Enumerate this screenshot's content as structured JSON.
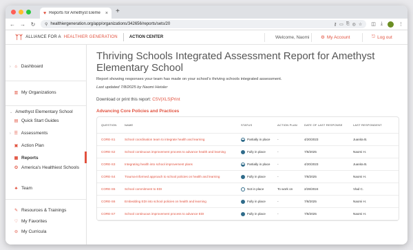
{
  "browser": {
    "tab_title": "Reports for Amethyst Eleme",
    "url": "healthiergeneration.org/app/organizations/342656/reports/sets/20"
  },
  "header": {
    "logo_part1": "ALLIANCE FOR A",
    "logo_part2": "HEALTHIER GENERATION",
    "action_center": "ACTION CENTER",
    "welcome": "Welcome, Naomi",
    "my_account": "My Account",
    "log_out": "Log out"
  },
  "sidebar": {
    "dashboard": "Dashboard",
    "my_organizations": "My Organizations",
    "school": "Amethyst Elementary School",
    "quick_start": "Quick Start Guides",
    "assessments": "Assessments",
    "action_plan": "Action Plan",
    "reports": "Reports",
    "healthiest_schools": "America's Healthiest Schools",
    "team": "Team",
    "resources": "Resources & Trainings",
    "favorites": "My Favorites",
    "curricula": "My Curricula"
  },
  "main": {
    "title": "Thriving Schools Integrated Assessment Report for Amethyst Elementary School",
    "description": "Report showing responses your team has made on your school's thriving schools integrated assessment.",
    "updated": "Last updated 7/8/2025 by Naomi Heisler",
    "download_prefix": "Download or print this report:",
    "csv": "CSV",
    "xls": "XLS",
    "print": "Print",
    "section": "Advancing Core Policies and Practices",
    "columns": [
      "Question",
      "Name",
      "Status",
      "Action Plan",
      "Date of Last Response",
      "Last Respondent"
    ],
    "rows": [
      {
        "code": "CORE-S1",
        "name": "School coordination team to integrate health and learning",
        "status": "Partially in place",
        "status_kind": "part",
        "plan": "-",
        "date": "4/20/2023",
        "respondent": "Juanita B."
      },
      {
        "code": "CORE-S2",
        "name": "School continuous improvement process to advance health and learning",
        "status": "Fully in place",
        "status_kind": "full",
        "plan": "-",
        "date": "7/8/2025",
        "respondent": "Naomi H."
      },
      {
        "code": "CORE-S3",
        "name": "Integrating health into school improvement plans",
        "status": "Partially in place",
        "status_kind": "part",
        "plan": "-",
        "date": "4/20/2023",
        "respondent": "Juanita B."
      },
      {
        "code": "CORE-S4",
        "name": "Trauma-informed approach to school policies on health and learning",
        "status": "Fully in place",
        "status_kind": "full",
        "plan": "-",
        "date": "7/8/2025",
        "respondent": "Naomi H."
      },
      {
        "code": "CORE-S5",
        "name": "School commitment to EDI",
        "status": "Not in place",
        "status_kind": "none",
        "plan": "To work on",
        "date": "2/28/2024",
        "respondent": "Vlad C."
      },
      {
        "code": "CORE-S6",
        "name": "Embedding EDI into school policies on health and learning",
        "status": "Fully in place",
        "status_kind": "full",
        "plan": "-",
        "date": "7/8/2025",
        "respondent": "Naomi H."
      },
      {
        "code": "CORE-S7",
        "name": "School continuous improvement process to advance EDI",
        "status": "Fully in place",
        "status_kind": "full",
        "plan": "-",
        "date": "7/8/2025",
        "respondent": "Naomi H."
      }
    ]
  },
  "colors": {
    "accent": "#e1513e",
    "status": "#2f6b8a"
  }
}
